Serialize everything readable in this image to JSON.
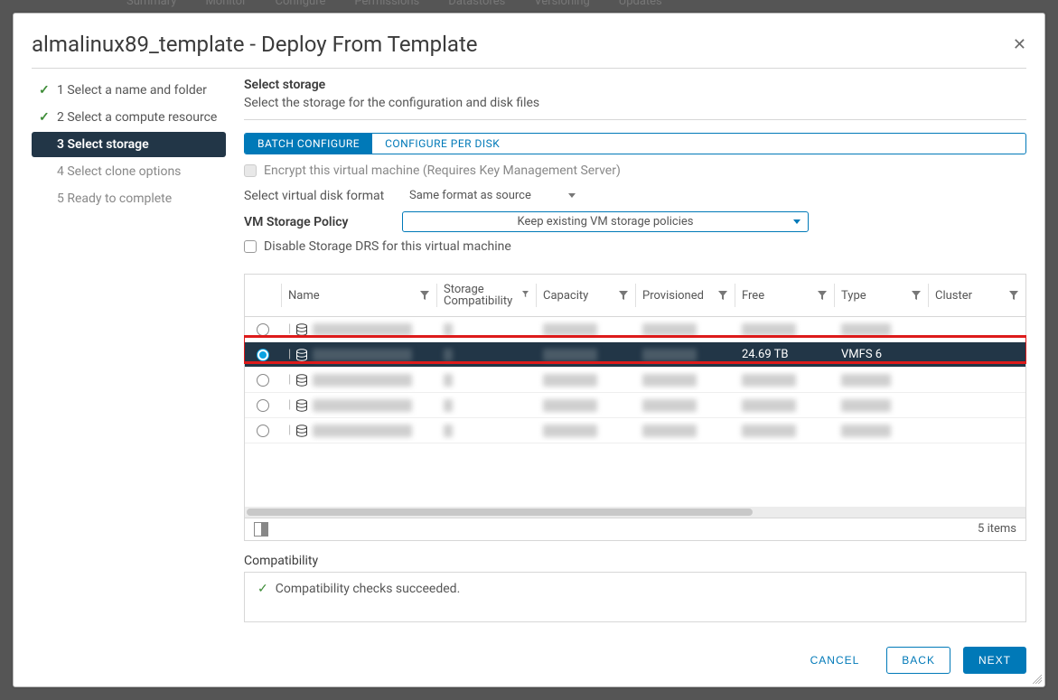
{
  "bg_tabs": [
    "Summary",
    "Monitor",
    "Configure",
    "Permissions",
    "Datastores",
    "Versioning",
    "Updates"
  ],
  "modal_title": "almalinux89_template - Deploy From Template",
  "wizard": {
    "s1": "1 Select a name and folder",
    "s2": "2 Select a compute resource",
    "s3": "3 Select storage",
    "s4": "4 Select clone options",
    "s5": "5 Ready to complete"
  },
  "section": {
    "title": "Select storage",
    "subtitle": "Select the storage for the configuration and disk files"
  },
  "seg": {
    "batch": "BATCH CONFIGURE",
    "perdisk": "CONFIGURE PER DISK"
  },
  "encrypt_label": "Encrypt this virtual machine (Requires Key Management Server)",
  "disk_format_label": "Select virtual disk format",
  "disk_format_value": "Same format as source",
  "policy_label": "VM Storage Policy",
  "policy_value": "Keep existing VM storage policies",
  "disable_drs_label": "Disable Storage DRS for this virtual machine",
  "table": {
    "headers": {
      "name": "Name",
      "compat": "Storage Compatibility",
      "capacity": "Capacity",
      "provisioned": "Provisioned",
      "free": "Free",
      "type": "Type",
      "cluster": "Cluster"
    },
    "rows": [
      {
        "selected": false,
        "name": "",
        "compat": "",
        "capacity": "",
        "provisioned": "",
        "free": "",
        "type": "",
        "cluster": ""
      },
      {
        "selected": true,
        "name": "",
        "compat": "",
        "capacity": "",
        "provisioned": "",
        "free": "24.69 TB",
        "type": "VMFS 6",
        "cluster": ""
      },
      {
        "selected": false,
        "name": "",
        "compat": "",
        "capacity": "",
        "provisioned": "",
        "free": "",
        "type": "",
        "cluster": ""
      },
      {
        "selected": false,
        "name": "",
        "compat": "",
        "capacity": "",
        "provisioned": "",
        "free": "",
        "type": "",
        "cluster": ""
      },
      {
        "selected": false,
        "name": "",
        "compat": "",
        "capacity": "",
        "provisioned": "",
        "free": "",
        "type": "",
        "cluster": ""
      }
    ],
    "footer_count": "5 items"
  },
  "compat_title": "Compatibility",
  "compat_msg": "Compatibility checks succeeded.",
  "buttons": {
    "cancel": "CANCEL",
    "back": "BACK",
    "next": "NEXT"
  }
}
